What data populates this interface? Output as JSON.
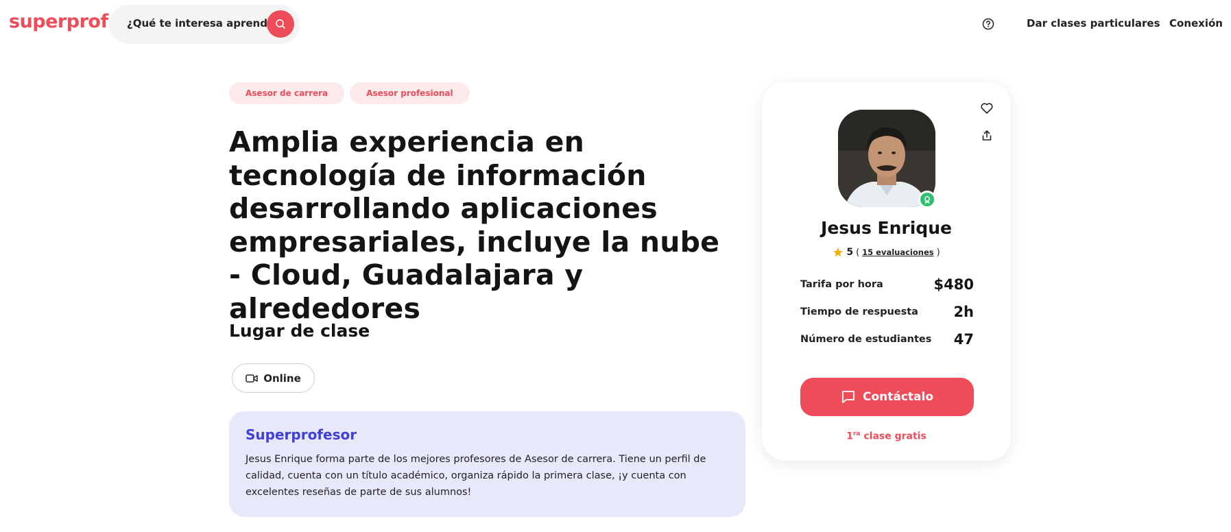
{
  "header": {
    "logo": "superprof",
    "search_placeholder": "¿Qué te interesa aprender?",
    "teach_link": "Dar clases particulares",
    "login_link": "Conexión"
  },
  "tags": [
    "Asesor de carrera",
    "Asesor profesional"
  ],
  "title": "Amplia experiencia en tecnología de información desarrollando aplicaciones empresariales, incluye la nube - Cloud, Guadalajara y alrededores",
  "location": {
    "heading": "Lugar de clase",
    "online_label": "Online"
  },
  "superprofesor": {
    "heading": "Superprofesor",
    "text": "Jesus Enrique forma parte de los mejores profesores de Asesor de carrera. Tiene un perfil de calidad, cuenta con un título académico, organiza rápido la primera clase, ¡y cuenta con excelentes reseñas de parte de sus alumnos!"
  },
  "card": {
    "name": "Jesus Enrique",
    "rating": "5",
    "reviews_open": "(",
    "reviews_link": "15 evaluaciones",
    "reviews_close": ")",
    "stats": [
      {
        "label": "Tarifa por hora",
        "value": "$480"
      },
      {
        "label": "Tiempo de respuesta",
        "value": "2h"
      },
      {
        "label": "Número de estudiantes",
        "value": "47"
      }
    ],
    "contact_label": "Contáctalo",
    "free_prefix": "1",
    "free_sup": "ra",
    "free_suffix": " clase gratis"
  },
  "colors": {
    "brand": "#ef4c5a",
    "superprof_bg": "#e8e8fb",
    "superprof_title": "#4040d8",
    "badge_green": "#2fbf71",
    "star": "#f5b000"
  }
}
